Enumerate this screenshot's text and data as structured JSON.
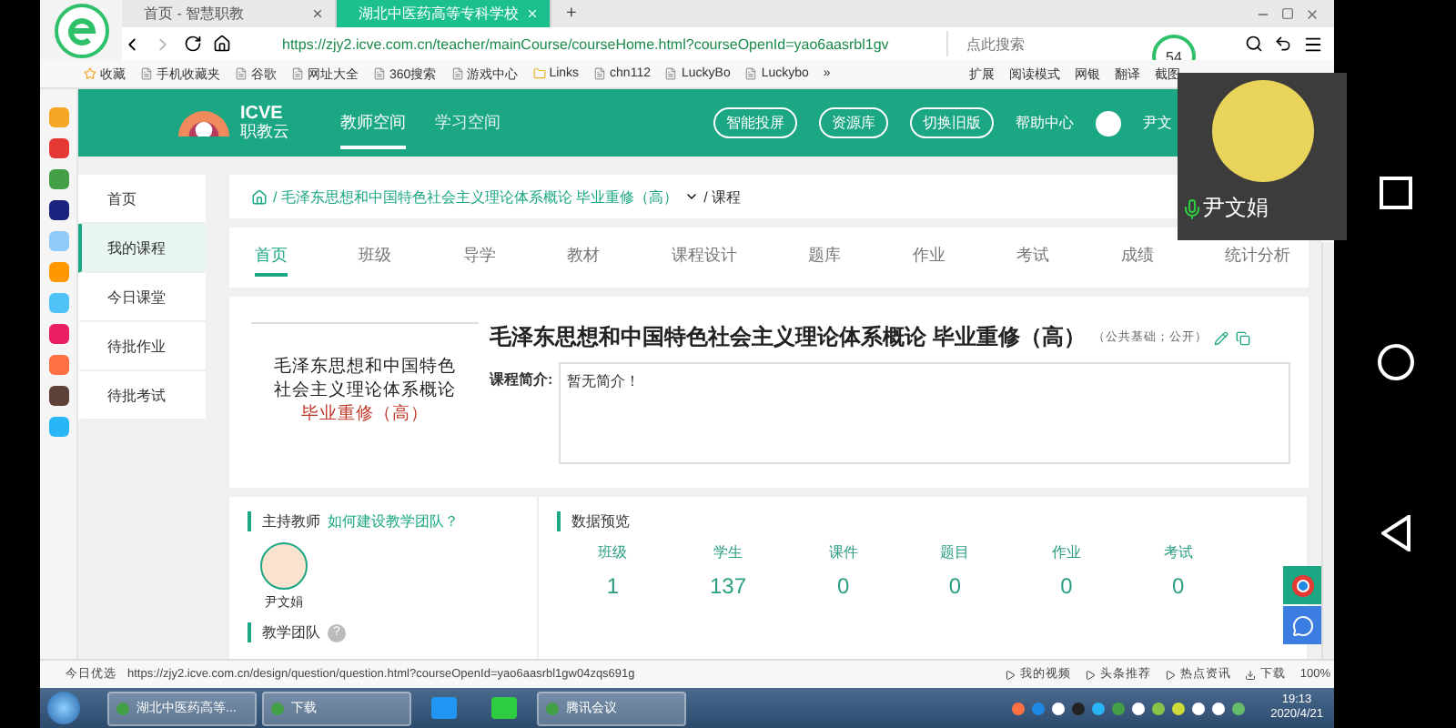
{
  "browser": {
    "tabs": [
      {
        "label": "首页 - 智慧职教",
        "selected": false
      },
      {
        "label": "湖北中医药高等专科学校",
        "selected": true
      }
    ],
    "new_tab": "+",
    "url": "https://zjy2.icve.com.cn/teacher/mainCourse/courseHome.html?courseOpenId=yao6aasrbl1gv",
    "search": {
      "placeholder": "点此搜索"
    },
    "badge": "54",
    "bookmarks": [
      "收藏",
      "手机收藏夹",
      "谷歌",
      "网址大全",
      "360搜索",
      "游戏中心",
      "Links",
      "chn112",
      "LuckyBo",
      "Luckybo"
    ],
    "bookmarks_more": "»",
    "tools": [
      "扩展",
      "阅读模式",
      "网银",
      "翻译",
      "截图"
    ]
  },
  "site": {
    "logo_top": "ICVE",
    "logo_bottom": "职教云",
    "nav": [
      {
        "label": "教师空间",
        "selected": true
      },
      {
        "label": "学习空间",
        "selected": false
      }
    ],
    "buttons": [
      "智能投屏",
      "资源库",
      "切换旧版"
    ],
    "help": "帮助中心",
    "user": "尹文"
  },
  "sidebar": [
    {
      "label": "首页",
      "selected": false
    },
    {
      "label": "我的课程",
      "selected": true
    },
    {
      "label": "今日课堂",
      "selected": false
    },
    {
      "label": "待批作业",
      "selected": false
    },
    {
      "label": "待批考试",
      "selected": false
    }
  ],
  "breadcrumb": {
    "course": "/ 毛泽东思想和中国特色社会主义理论体系概论 毕业重修（高）",
    "current": "/ 课程"
  },
  "course_tabs": [
    {
      "label": "首页",
      "selected": true
    },
    {
      "label": "班级",
      "selected": false
    },
    {
      "label": "导学",
      "selected": false
    },
    {
      "label": "教材",
      "selected": false
    },
    {
      "label": "课程设计",
      "selected": false
    },
    {
      "label": "题库",
      "selected": false
    },
    {
      "label": "作业",
      "selected": false
    },
    {
      "label": "考试",
      "selected": false
    },
    {
      "label": "成绩",
      "selected": false
    },
    {
      "label": "统计分析",
      "selected": false
    }
  ],
  "course": {
    "cover_lines": [
      "毛泽东思想和中国特色",
      "社会主义理论体系概论"
    ],
    "cover_sub": "毕业重修（高）",
    "title": "毛泽东思想和中国特色社会主义理论体系概论 毕业重修（高）",
    "tag": "（公共基础；公开）",
    "intro_label": "课程简介:",
    "intro": "暂无简介！"
  },
  "teachers": {
    "heading": "主持教师",
    "link": "如何建设教学团队？",
    "name": "尹文娟",
    "team": "教学团队",
    "help": "?"
  },
  "stats": {
    "heading": "数据预览",
    "items": [
      {
        "label": "班级",
        "value": "1"
      },
      {
        "label": "学生",
        "value": "137"
      },
      {
        "label": "课件",
        "value": "0"
      },
      {
        "label": "题目",
        "value": "0"
      },
      {
        "label": "作业",
        "value": "0"
      },
      {
        "label": "考试",
        "value": "0"
      }
    ]
  },
  "status_bar": {
    "label": "今日优选",
    "url": "https://zjy2.icve.com.cn/design/question/question.html?courseOpenId=yao6aasrbl1gw04zqs691g",
    "items": [
      "我的视频",
      "头条推荐",
      "热点资讯"
    ],
    "download": "下载",
    "zoom": "100%"
  },
  "taskbar": {
    "apps": [
      "湖北中医药高等...",
      "下载",
      "腾讯会议"
    ],
    "time": "19:13",
    "date": "2020/4/21"
  },
  "video": {
    "name": "尹文娟"
  }
}
